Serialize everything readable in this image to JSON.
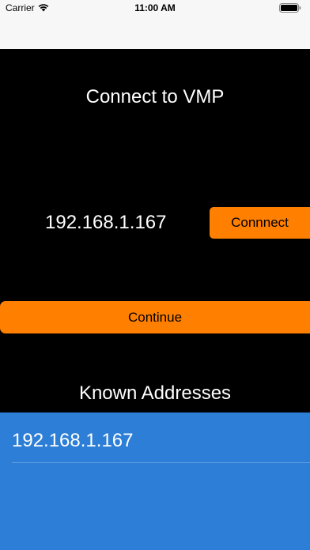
{
  "status_bar": {
    "carrier": "Carrier",
    "time": "11:00 AM",
    "wifi_icon": "wifi-icon",
    "battery_icon": "battery-icon"
  },
  "main": {
    "title": "Connect to VMP",
    "ip_value": "192.168.1.167",
    "connect_label": "Connnect",
    "continue_label": "Continue",
    "known_heading": "Known Addresses"
  },
  "known_addresses": [
    {
      "address": "192.168.1.167"
    }
  ],
  "colors": {
    "accent": "#ff7f00",
    "list_background": "#2d7ed6",
    "background": "#000000"
  }
}
